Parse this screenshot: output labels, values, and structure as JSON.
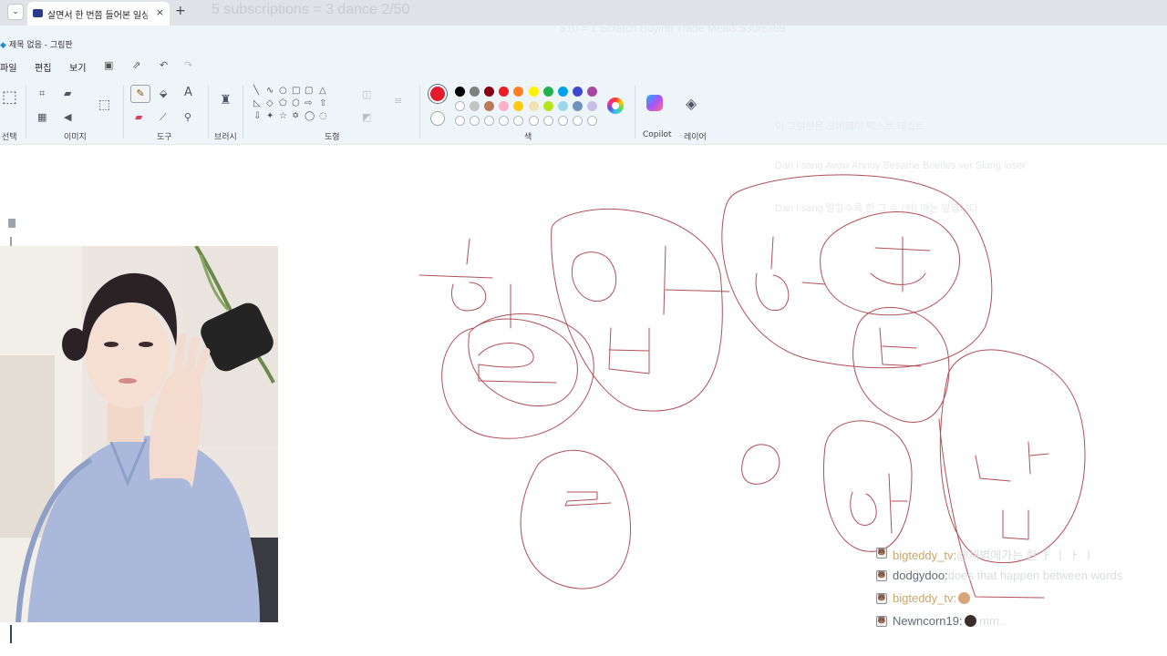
{
  "browser": {
    "tab_title": "살면서 한 번쯤 들어본 일상 소",
    "tab_close": "×",
    "new_tab": "+",
    "menu_glyph": "⌄"
  },
  "overlays": {
    "subscriptions_goal": "5 subscriptions = 3 dance 2/50",
    "price_line": "$10 = 1 Scratch Buying Trade Meals $30/$369",
    "faint_lines": [
      "이 그림판은 오버레이 텍스트 테스트",
      "Dan i sang Avow Annoy Sesame Beetles ver Slang loser",
      "Dan i sang 말할수록 한 그 수 (쉬) 때는 앞입니다"
    ]
  },
  "paint": {
    "window_title": "제목 없음 - 그림판",
    "menu": [
      "파일",
      "편집",
      "보기"
    ],
    "groups": {
      "select_label": "선택",
      "image_label": "이미지",
      "tools_label": "도구",
      "brush_label": "브러시",
      "shapes_label": "도형",
      "colors_label": "색",
      "copilot_label": "Copilot",
      "layers_label": "레이어"
    },
    "current_color": "#e21c2c",
    "palette_row1": [
      "#000000",
      "#7f7f7f",
      "#880015",
      "#ed1c24",
      "#ff7f27",
      "#fff200",
      "#22b14c",
      "#00a2e8",
      "#3f48cc",
      "#a349a4"
    ],
    "palette_row2": [
      "#ffffff",
      "#c3c3c3",
      "#b97a57",
      "#ffaec9",
      "#ffc90e",
      "#efe4b0",
      "#b5e61d",
      "#99d9ea",
      "#7092be",
      "#c8bfe7"
    ]
  },
  "chat": {
    "messages": [
      {
        "user": "bigteddy_tv:",
        "user_color": "#c9a66b",
        "text": "@새벽에가는 한 ㅏ ㅣ ㅏ ㅣ"
      },
      {
        "user": "dodgydoo:",
        "user_color": "#5f6b74",
        "text": "does that happen between words"
      },
      {
        "user": "bigteddy_tv:",
        "user_color": "#c9a66b",
        "text": ""
      },
      {
        "user": "Newncorn19:",
        "user_color": "#5f6b74",
        "text": "mm.."
      }
    ]
  }
}
